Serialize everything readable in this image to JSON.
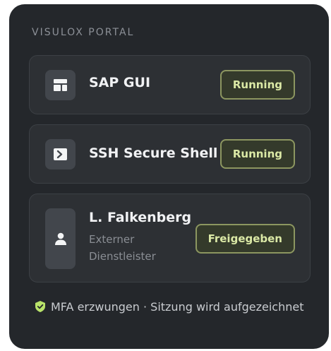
{
  "portal": {
    "title": "VISULOX PORTAL"
  },
  "cards": [
    {
      "title": "SAP GUI",
      "icon": "layout-icon",
      "badge": "Running"
    },
    {
      "title": "SSH Secure Shell",
      "icon": "terminal-icon",
      "badge": "Running"
    },
    {
      "title": "L. Falkenberg",
      "subtitle": "Externer Dienstleister",
      "icon": "user-icon",
      "badge": "Freigegeben"
    }
  ],
  "footer": {
    "text": "MFA erzwungen · Sitzung wird aufgezeichnet",
    "icon": "shield-check-icon"
  },
  "colors": {
    "panel": "#24272b",
    "card": "#2d3034",
    "badge_text": "#dbe9a6",
    "badge_border": "#8c9660",
    "shield": "#b9e36a"
  }
}
